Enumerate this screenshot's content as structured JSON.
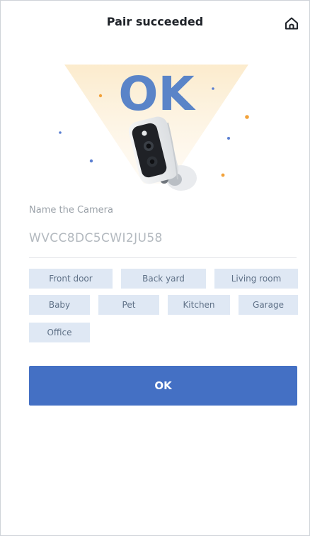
{
  "header": {
    "title": "Pair succeeded",
    "home_icon": "home-icon"
  },
  "hero": {
    "ok_text": "OK",
    "camera_icon": "camera-icon",
    "sparkle_icon": "sparkle-icon"
  },
  "name_section": {
    "label": "Name the Camera",
    "value": "WVCC8DC5CWI2JU58"
  },
  "chips": [
    "Front door",
    "Back yard",
    "Living room",
    "Baby",
    "Pet",
    "Kitchen",
    "Garage",
    "Office"
  ],
  "ok_button": {
    "label": "OK"
  },
  "colors": {
    "primary": "#4470c4",
    "chip_bg": "#dfe8f4",
    "ok_graphic": "#5a84c8",
    "sparkle_orange": "#f2a23a",
    "sparkle_blue": "#5b7fd1"
  }
}
